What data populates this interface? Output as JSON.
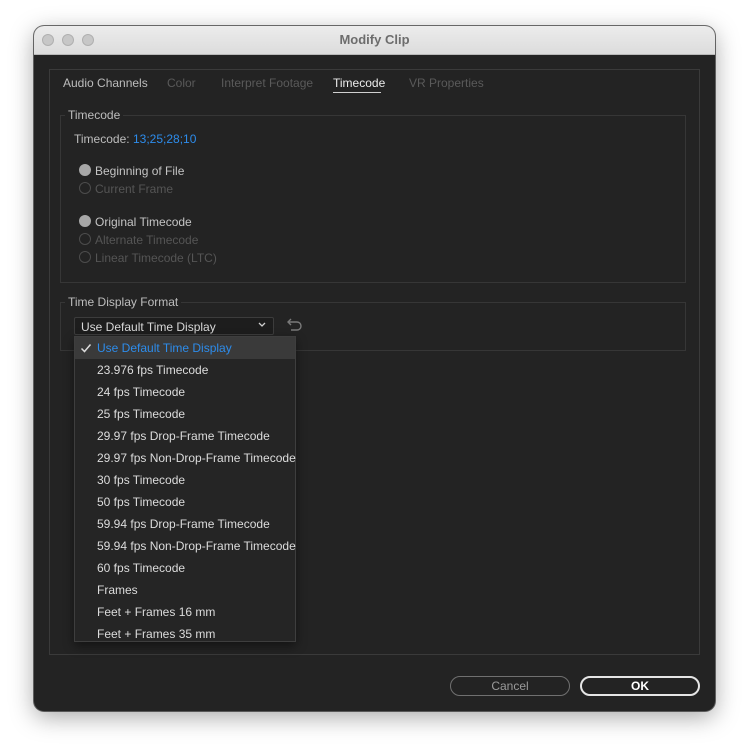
{
  "window": {
    "title": "Modify Clip"
  },
  "tabs": [
    {
      "label": "Audio Channels",
      "state": "enabled"
    },
    {
      "label": "Color",
      "state": "disabled"
    },
    {
      "label": "Interpret Footage",
      "state": "disabled"
    },
    {
      "label": "Timecode",
      "state": "active"
    },
    {
      "label": "VR Properties",
      "state": "disabled"
    }
  ],
  "timecode_group": {
    "legend": "Timecode",
    "field_label": "Timecode:",
    "field_value": "13;25;28;10",
    "source_options": [
      {
        "label": "Beginning of File",
        "selected": true,
        "enabled": true
      },
      {
        "label": "Current Frame",
        "selected": false,
        "enabled": false
      }
    ],
    "type_options": [
      {
        "label": "Original Timecode",
        "selected": true,
        "enabled": true
      },
      {
        "label": "Alternate Timecode",
        "selected": false,
        "enabled": false
      },
      {
        "label": "Linear Timecode (LTC)",
        "selected": false,
        "enabled": false
      }
    ]
  },
  "display_format_group": {
    "legend": "Time Display Format",
    "selected": "Use Default Time Display",
    "options": [
      "Use Default Time Display",
      "23.976 fps Timecode",
      "24 fps Timecode",
      "25 fps Timecode",
      "29.97 fps Drop-Frame Timecode",
      "29.97 fps Non-Drop-Frame Timecode",
      "30 fps Timecode",
      "50 fps Timecode",
      "59.94 fps Drop-Frame Timecode",
      "59.94 fps Non-Drop-Frame Timecode",
      "60 fps Timecode",
      "Frames",
      "Feet + Frames 16 mm",
      "Feet + Frames 35 mm"
    ],
    "checked_index": 0
  },
  "buttons": {
    "cancel": "Cancel",
    "ok": "OK"
  },
  "colors": {
    "accent": "#2d8ceb",
    "background": "#232323"
  }
}
